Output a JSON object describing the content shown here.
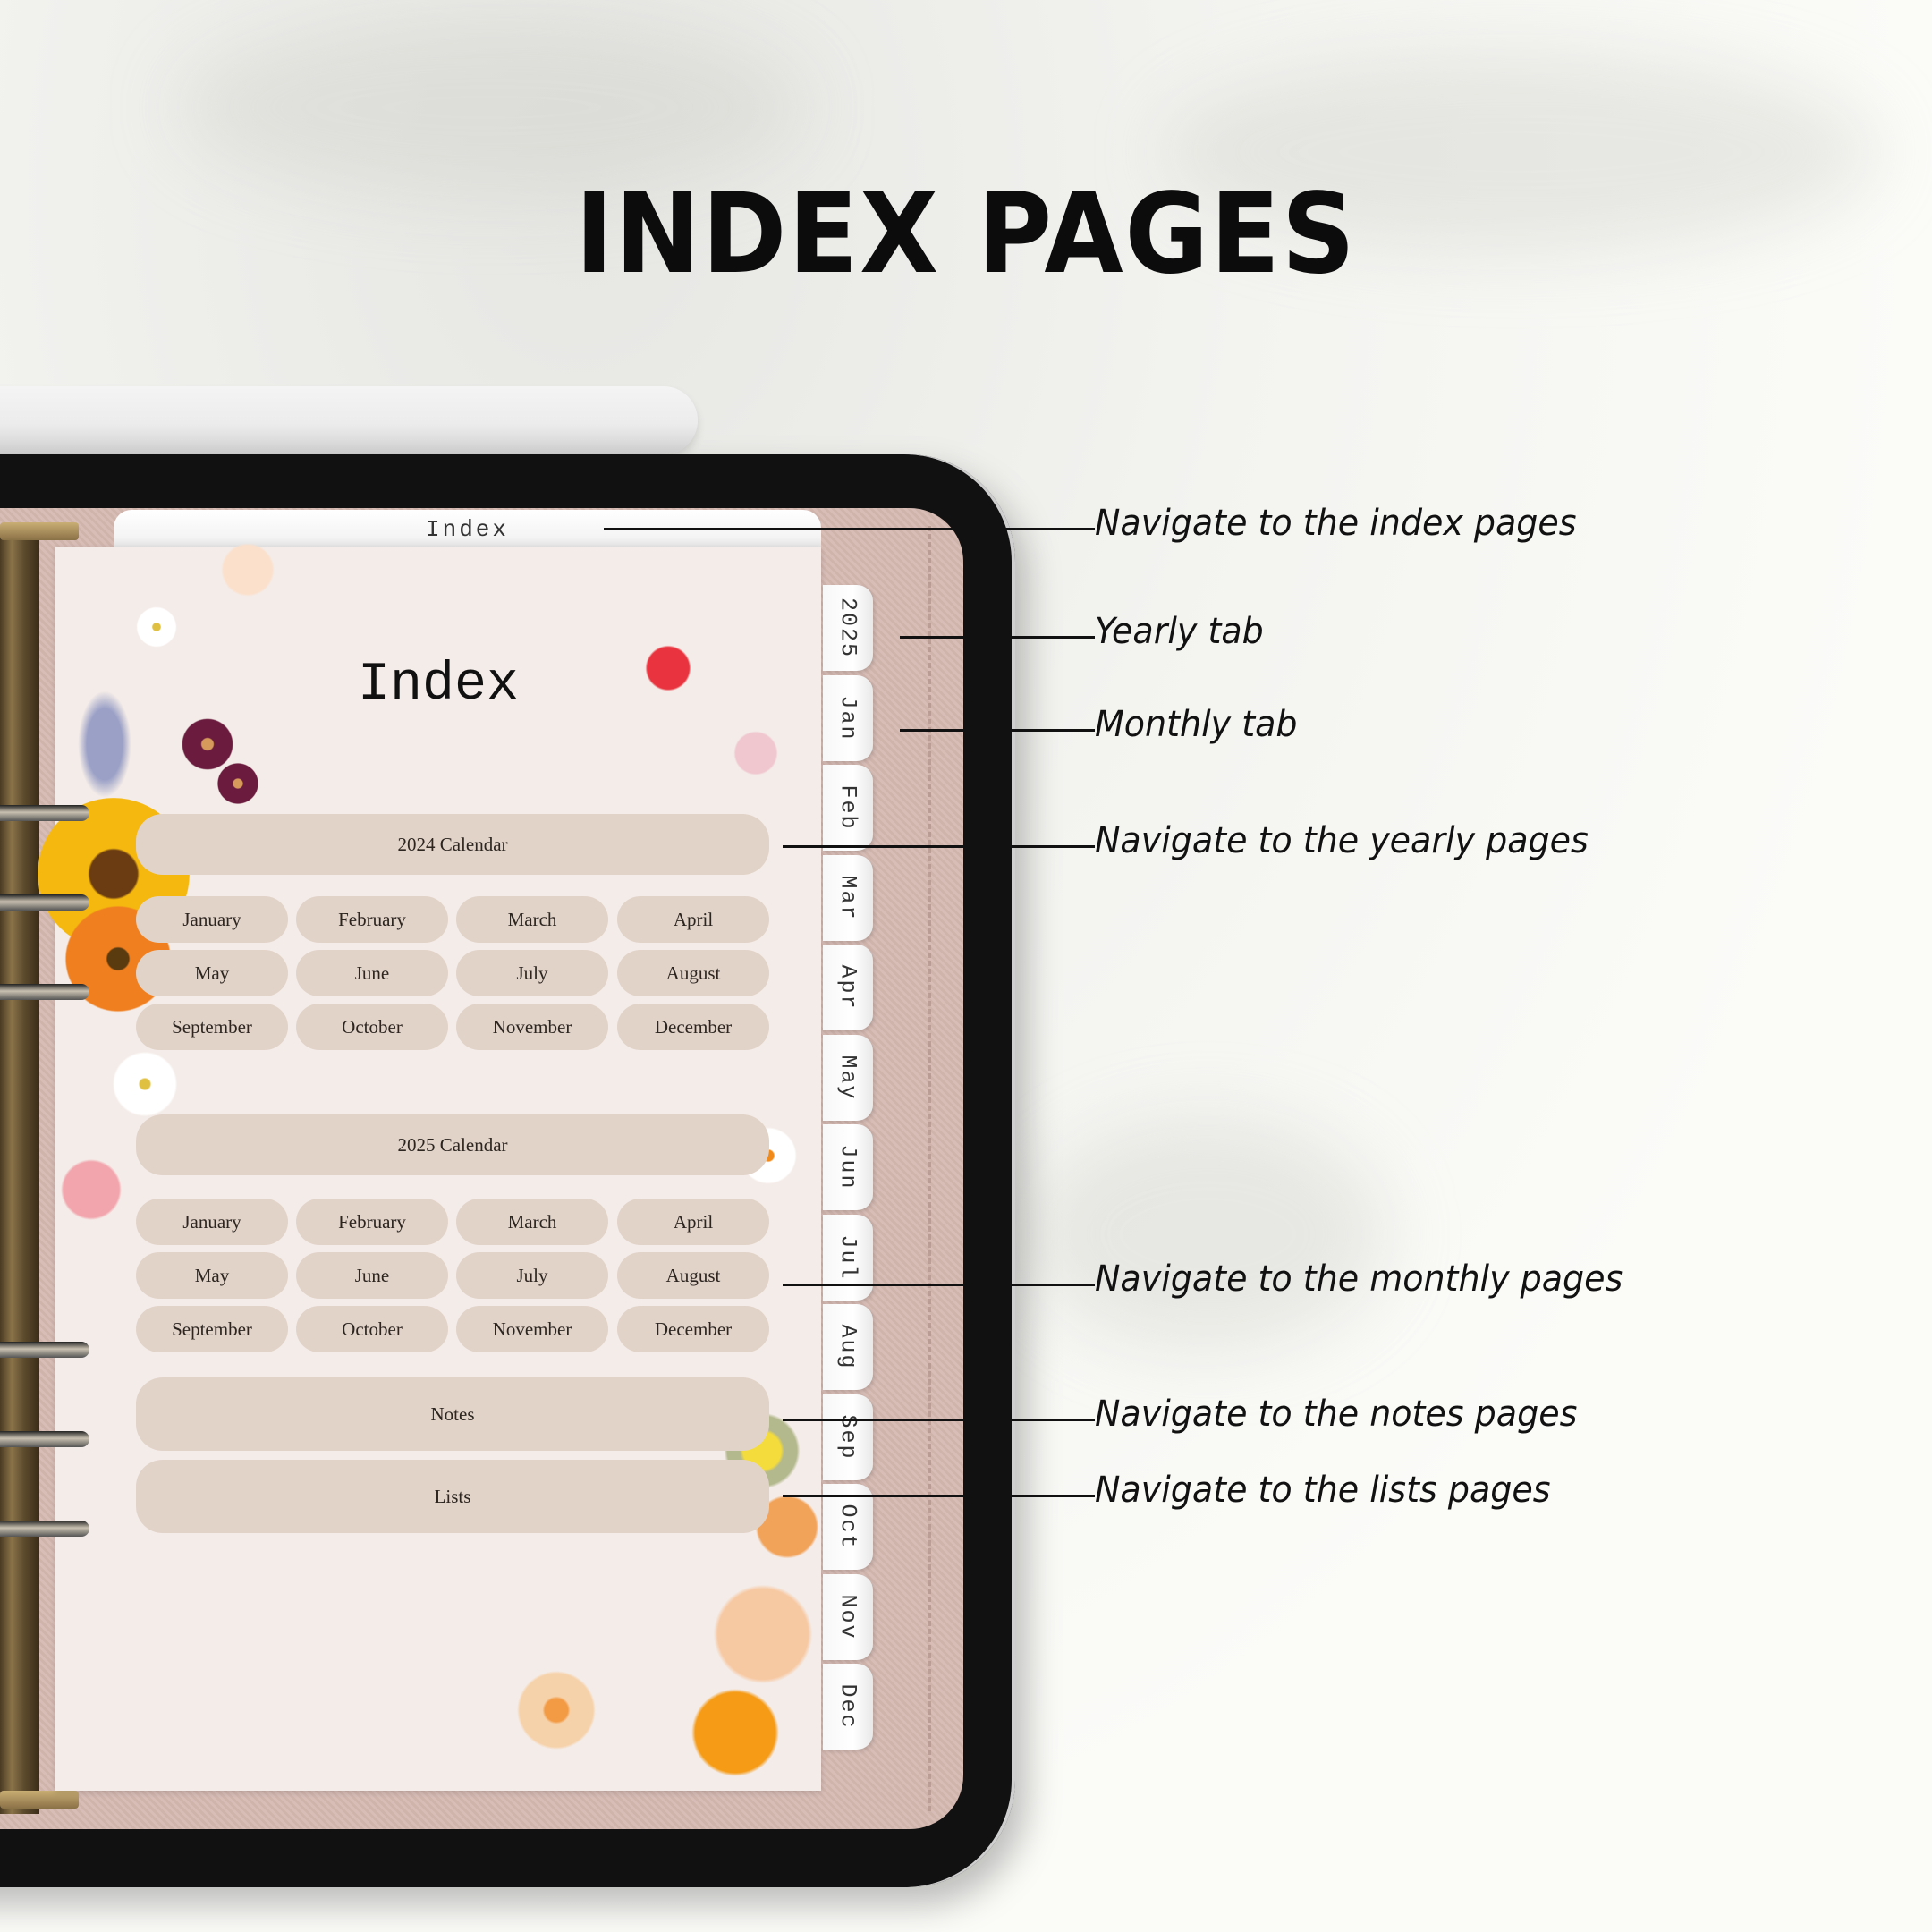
{
  "headline": "INDEX PAGES",
  "planner": {
    "top_tab": "Index",
    "page_title": "Index",
    "calendar_2024": {
      "label": "2024 Calendar",
      "months": [
        "January",
        "February",
        "March",
        "April",
        "May",
        "June",
        "July",
        "August",
        "September",
        "October",
        "November",
        "December"
      ]
    },
    "calendar_2025": {
      "label": "2025 Calendar",
      "months": [
        "January",
        "February",
        "March",
        "April",
        "May",
        "June",
        "July",
        "August",
        "September",
        "October",
        "November",
        "December"
      ]
    },
    "notes_label": "Notes",
    "lists_label": "Lists",
    "side_tabs": [
      "2025",
      "Jan",
      "Feb",
      "Mar",
      "Apr",
      "May",
      "Jun",
      "Jul",
      "Aug",
      "Sep",
      "Oct",
      "Nov",
      "Dec"
    ]
  },
  "callouts": [
    {
      "name": "index",
      "text": "Navigate to the index pages"
    },
    {
      "name": "yearly-tab",
      "text": "Yearly tab"
    },
    {
      "name": "monthly-tab",
      "text": "Monthly tab"
    },
    {
      "name": "yearly-pages",
      "text": "Navigate to the yearly pages"
    },
    {
      "name": "monthly-pages",
      "text": "Navigate to the monthly pages"
    },
    {
      "name": "notes-pages",
      "text": "Navigate to the notes pages"
    },
    {
      "name": "lists-pages",
      "text": "Navigate to the lists pages"
    }
  ],
  "colors": {
    "pill": "#e2d3c9",
    "page": "#f4ece8",
    "cover": "#d7bdb6",
    "bezel": "#111111"
  }
}
